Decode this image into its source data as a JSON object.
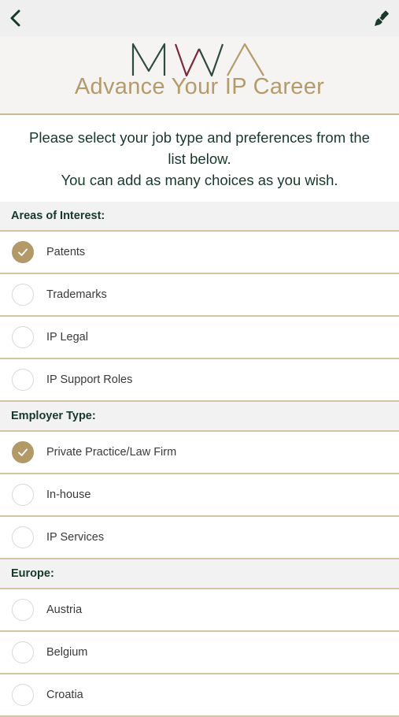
{
  "nav": {
    "back_icon": "chevron-left-icon",
    "brush_icon": "brush-icon"
  },
  "brand": {
    "logo_text": "MWA",
    "title": "Advance Your IP Career",
    "colors": {
      "gold": "#b59a6a",
      "dark_green": "#16392a"
    }
  },
  "intro": {
    "line1": "Please select your job type and preferences from the",
    "line2": "list below.",
    "line3": "You can add as many choices as you wish."
  },
  "sections": [
    {
      "title": "Areas of Interest:",
      "options": [
        {
          "label": "Patents",
          "checked": true
        },
        {
          "label": "Trademarks",
          "checked": false
        },
        {
          "label": "IP Legal",
          "checked": false
        },
        {
          "label": "IP Support Roles",
          "checked": false
        }
      ]
    },
    {
      "title": "Employer Type:",
      "options": [
        {
          "label": "Private Practice/Law Firm",
          "checked": true
        },
        {
          "label": "In-house",
          "checked": false
        },
        {
          "label": "IP Services",
          "checked": false
        }
      ]
    },
    {
      "title": "Europe:",
      "options": [
        {
          "label": "Austria",
          "checked": false
        },
        {
          "label": "Belgium",
          "checked": false
        },
        {
          "label": "Croatia",
          "checked": false
        }
      ]
    }
  ]
}
